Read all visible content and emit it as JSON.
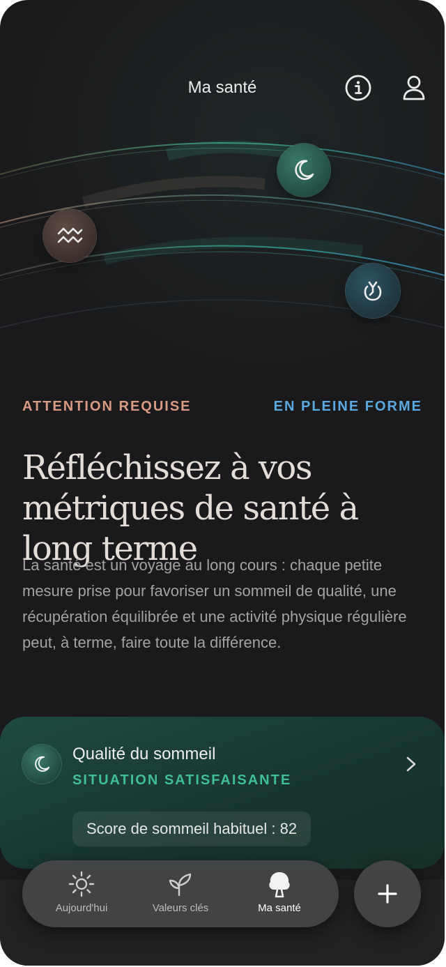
{
  "header": {
    "title": "Ma santé",
    "info_icon": "info-icon",
    "profile_icon": "user-icon"
  },
  "metrics_visual": {
    "badges": [
      "moon-icon",
      "wave-icon",
      "activity-icon"
    ]
  },
  "status_labels": {
    "attention": "ATTENTION REQUISE",
    "fit": "EN PLEINE FORME"
  },
  "content": {
    "headline": "Réfléchissez à vos métriques de santé à long terme",
    "body": "La santé est un voyage au long cours : chaque petite mesure prise pour favoriser un sommeil de qualité, une récupération équilibrée et une activité physique régulière peut, à terme, faire toute la différence."
  },
  "sleep_card": {
    "title": "Qualité du sommeil",
    "status": "SITUATION SATISFAISANTE",
    "score_label": "Score de sommeil habituel : 82",
    "icon": "moon-icon"
  },
  "nav": {
    "items": [
      {
        "label": "Aujourd'hui",
        "icon": "sun-icon"
      },
      {
        "label": "Valeurs clés",
        "icon": "sprout-icon"
      },
      {
        "label": "Ma santé",
        "icon": "tree-icon"
      }
    ],
    "active": "Ma santé",
    "fab_icon": "plus-icon"
  },
  "colors": {
    "background": "#1a1a1c",
    "attention": "#d99a84",
    "fit": "#5aa9e0",
    "status_green": "#3fbf95",
    "card": "#1f4a41"
  }
}
